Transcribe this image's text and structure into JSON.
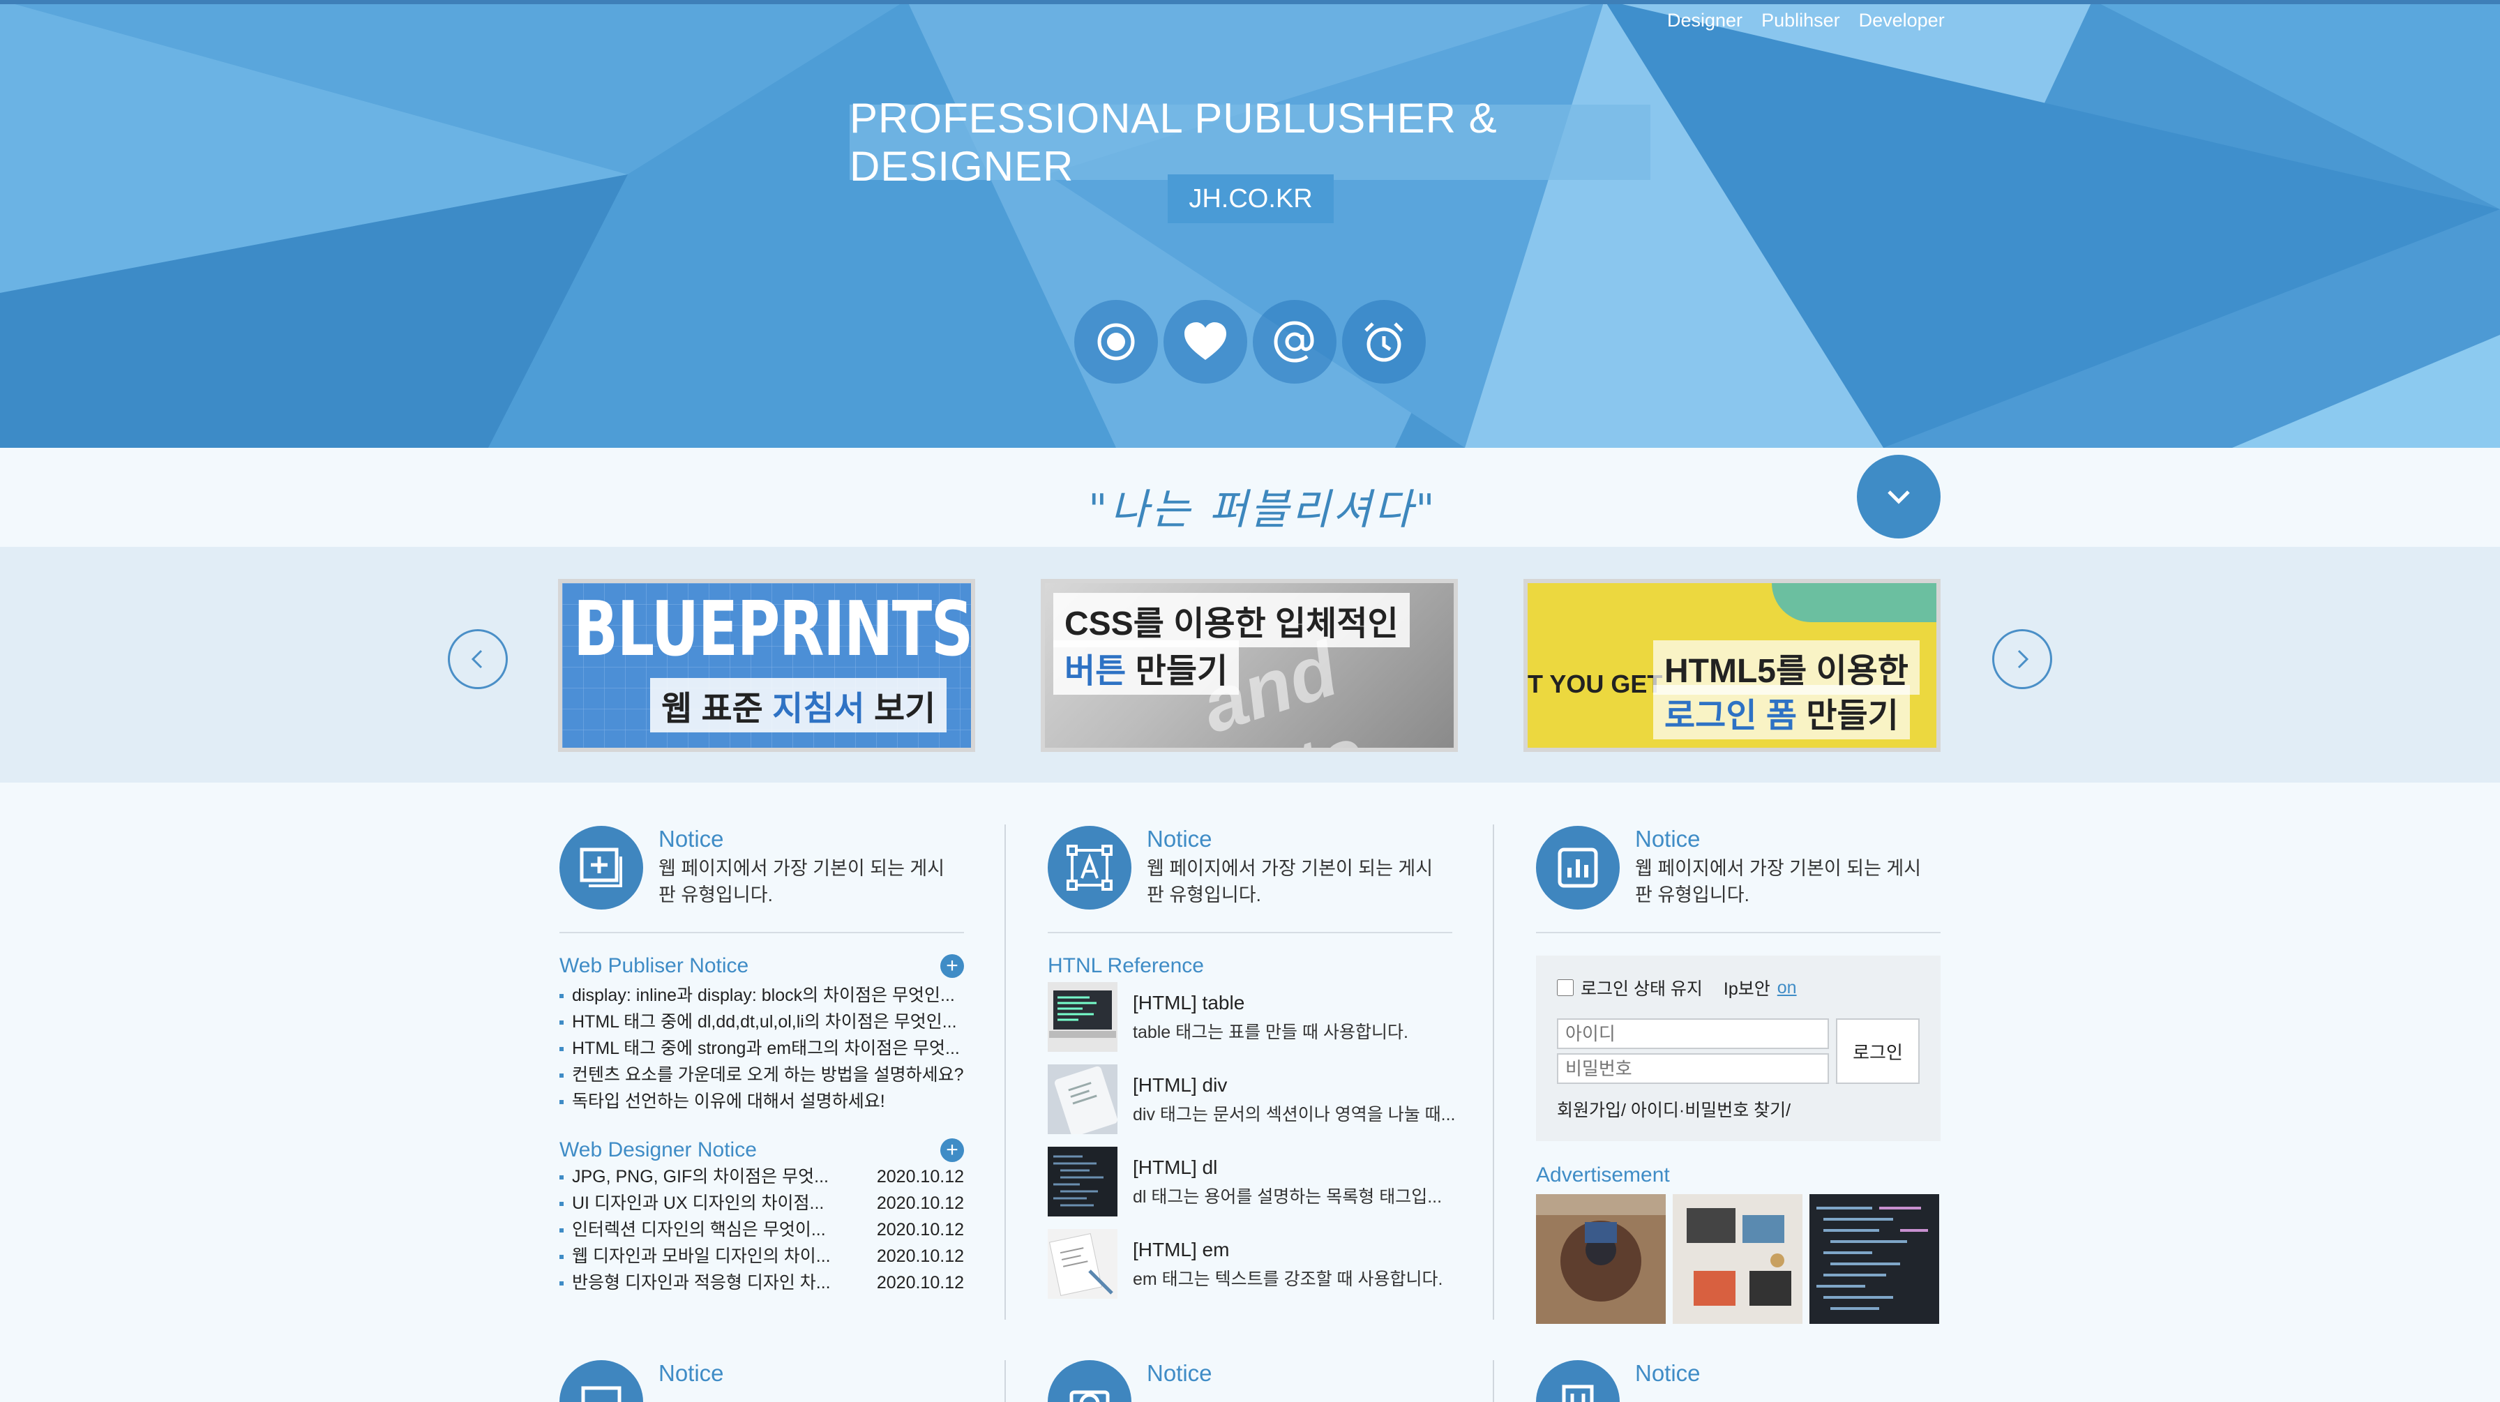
{
  "nav": [
    "Designer",
    "Publihser",
    "Developer"
  ],
  "hero": {
    "title": "PROFESSIONAL PUBLUSHER & DESIGNER",
    "subtitle": "JH.CO.KR",
    "icons": [
      "target-icon",
      "heart-icon",
      "at-icon",
      "alarm-clock-icon"
    ]
  },
  "slogan": "\"나는 퍼블리셔다\"",
  "banners": [
    {
      "big": "BLUEPRINTS",
      "cap_a": "웹 표준 ",
      "cap_b": "지침서",
      "cap_c": " 보기"
    },
    {
      "line1": "CSS를 이용한 입체적인",
      "line2_a": "버튼",
      "line2_b": " 만들기"
    },
    {
      "tag": "T YOU GET",
      "line1": "HTML5를 이용한",
      "line2_a": "로그인 폼",
      "line2_b": " 만들기"
    }
  ],
  "notice": {
    "title": "Notice",
    "desc": "웹 페이지에서 가장 기본이 되는 게시판 유형입니다."
  },
  "col1": {
    "sec1_title": "Web Publiser Notice",
    "sec1_items": [
      "display: inline과 display: block의 차이점은 무엇인...",
      "HTML 태그 중에 dl,dd,dt,ul,ol,li의 차이점은 무엇인...",
      "HTML 태그 중에 strong과 em태그의 차이점은 무엇...",
      "컨텐츠 요소를 가운데로 오게 하는 방법을 설명하세요?",
      "독타입 선언하는 이유에 대해서 설명하세요!"
    ],
    "sec2_title": "Web Designer Notice",
    "sec2_items": [
      {
        "text": "JPG, PNG, GIF의 차이점은 무엇...",
        "date": "2020.10.12"
      },
      {
        "text": "UI 디자인과 UX 디자인의 차이점...",
        "date": "2020.10.12"
      },
      {
        "text": "인터렉션 디자인의 핵심은 무엇이...",
        "date": "2020.10.12"
      },
      {
        "text": "웹 디자인과 모바일 디자인의 차이...",
        "date": "2020.10.12"
      },
      {
        "text": "반응형 디자인과 적응형 디자인 차...",
        "date": "2020.10.12"
      }
    ]
  },
  "col2": {
    "sec_title": "HTNL Reference",
    "items": [
      {
        "title": "[HTML] table",
        "desc": "table 태그는 표를 만들 때 사용합니다."
      },
      {
        "title": "[HTML] div",
        "desc": "div 태그는 문서의 섹션이나 영역을 나눌 때..."
      },
      {
        "title": "[HTML] dl",
        "desc": "dl 태그는 용어를 설명하는 목록형 태그입..."
      },
      {
        "title": "[HTML] em",
        "desc": "em 태그는 텍스트를 강조할 때 사용합니다."
      }
    ]
  },
  "col3": {
    "keep_login": "로그인 상태 유지",
    "ip_security": "Ip보안",
    "ip_on": "on",
    "id_placeholder": "아이디",
    "pw_placeholder": "비밀번호",
    "login_button": "로그인",
    "links": "회원가입/ 아이디·비밀번호 찾기/",
    "ad_title": "Advertisement"
  },
  "colors": {
    "accent": "#3f8cc6",
    "hero_bg": "#4a98d2"
  }
}
